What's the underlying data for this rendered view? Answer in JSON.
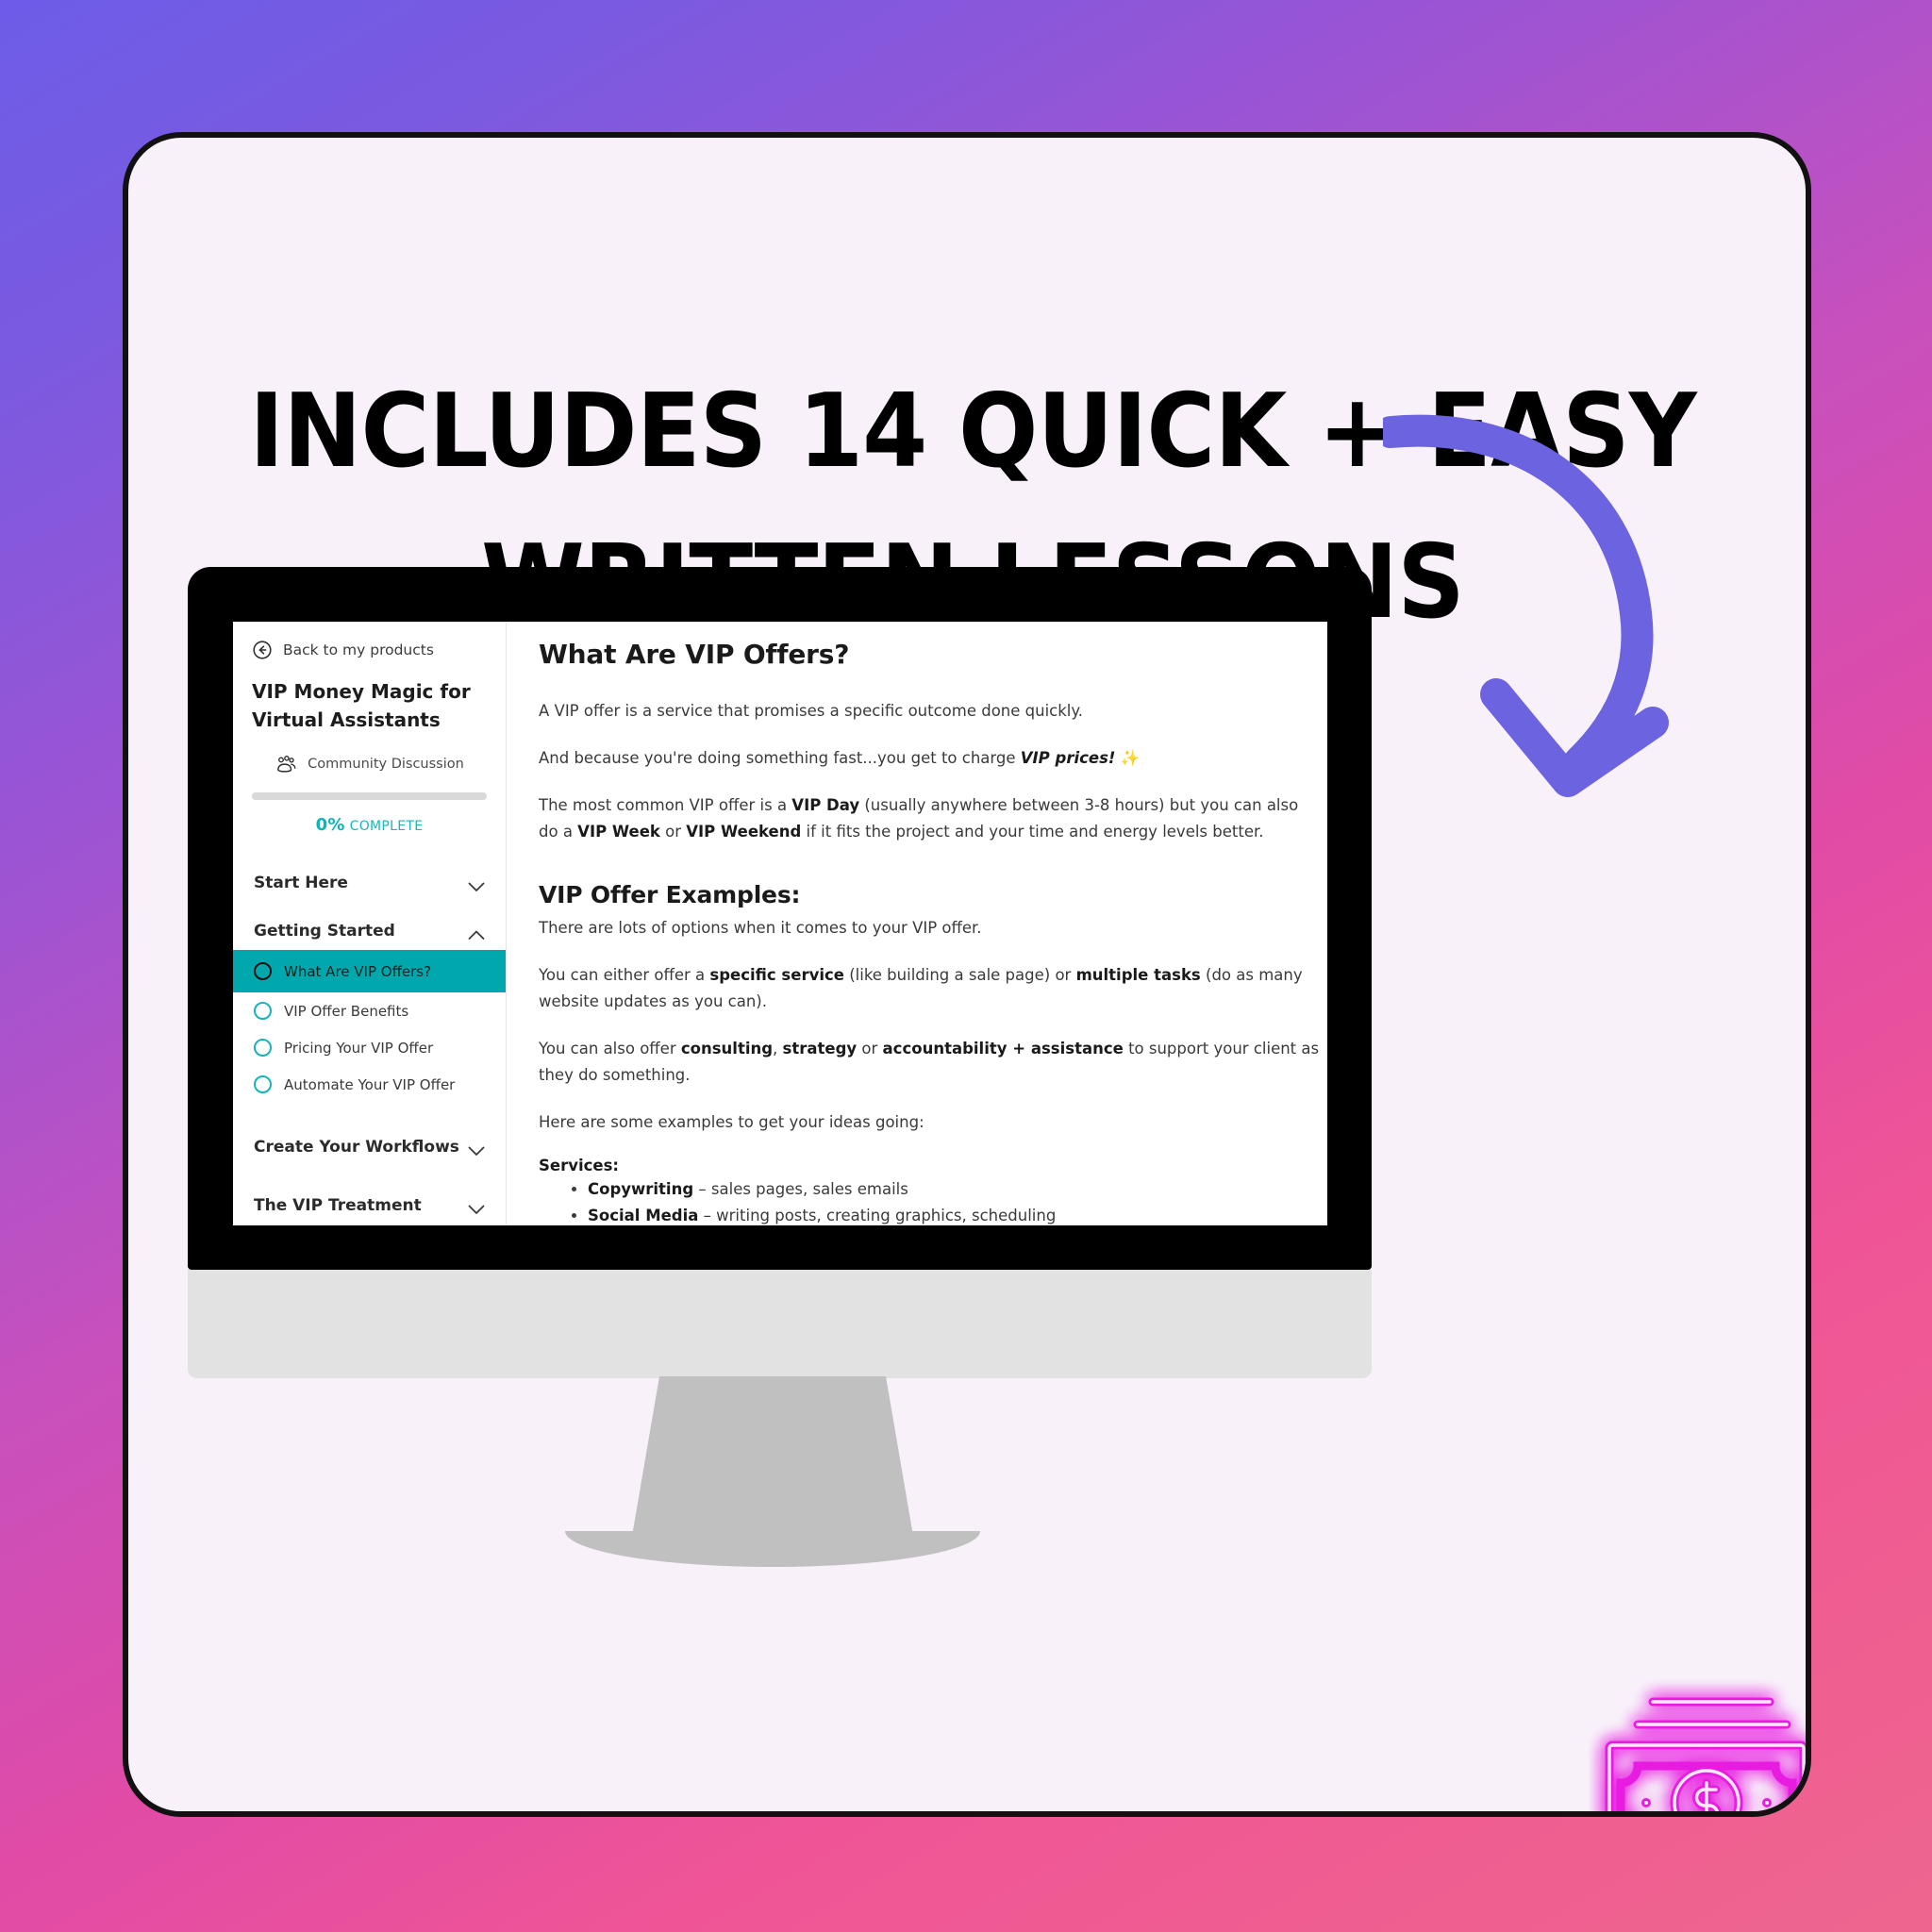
{
  "poster": {
    "headline_line1": "INCLUDES 14 QUICK + EASY",
    "headline_line2": "WRITTEN LESSONS",
    "arrow_icon": "curved-down-left-arrow-icon",
    "money_icon": "neon-banknote-dollar-icon",
    "colors": {
      "background_gradient_start": "#6d5ce8",
      "background_gradient_end": "#ee6690",
      "card_background": "#f8f1fa",
      "arrow": "#6c63e0",
      "neon": "#e01fd6",
      "accent_teal": "#00a8ad"
    }
  },
  "screen": {
    "sidebar": {
      "back_icon": "back-circle-arrow-icon",
      "back_label": "Back to my products",
      "course_title": "VIP Money Magic for Virtual Assistants",
      "community_icon": "community-people-icon",
      "community_label": "Community Discussion",
      "progress_percent": "0%",
      "progress_word": "COMPLETE",
      "progress_value": 0,
      "sections": [
        {
          "label": "Start Here",
          "chevron": "chevron-down-icon",
          "expanded": false,
          "lessons": []
        },
        {
          "label": "Getting Started",
          "chevron": "chevron-up-icon",
          "expanded": true,
          "lessons": [
            {
              "label": "What Are VIP Offers?",
              "active": true
            },
            {
              "label": "VIP Offer Benefits",
              "active": false
            },
            {
              "label": "Pricing Your VIP Offer",
              "active": false
            },
            {
              "label": "Automate Your VIP Offer",
              "active": false
            }
          ]
        },
        {
          "label": "Create Your Workflows",
          "chevron": "chevron-down-icon",
          "expanded": false,
          "lessons": []
        },
        {
          "label": "The VIP Treatment",
          "chevron": "chevron-down-icon",
          "expanded": false,
          "lessons": []
        }
      ]
    },
    "content": {
      "heading": "What Are VIP Offers?",
      "p1": "A VIP offer is a service that promises a specific outcome done quickly.",
      "p2_a": "And because you're doing something fast...you get to charge ",
      "p2_em": "VIP prices!",
      "p2_b": " ✨",
      "p3_a": "The most common VIP offer is a ",
      "p3_b1": "VIP Day",
      "p3_b": " (usually anywhere between 3-8 hours) but you can also do a ",
      "p3_b2": "VIP Week",
      "p3_c": " or ",
      "p3_b3": "VIP Weekend",
      "p3_d": " if it fits the project and your time and energy levels better.",
      "subheading": "VIP Offer Examples:",
      "p4": "There are lots of options when it comes to your VIP offer.",
      "p5_a": "You can either offer a ",
      "p5_b1": "specific service",
      "p5_b": " (like building a sale page) or ",
      "p5_b2": "multiple tasks",
      "p5_c": " (do as many website updates as you can).",
      "p6_a": "You can also offer ",
      "p6_b1": "consulting",
      "p6_b": ", ",
      "p6_b2": "strategy",
      "p6_c": " or ",
      "p6_b3": "accountability + assistance",
      "p6_d": " to support your client as they do something.",
      "p7": "Here are some examples to get your ideas going:",
      "services_label": "Services:",
      "services": [
        {
          "term": "Copywriting",
          "desc": " – sales pages, sales emails"
        },
        {
          "term": "Social Media",
          "desc": " – writing posts, creating graphics, scheduling"
        }
      ]
    }
  }
}
